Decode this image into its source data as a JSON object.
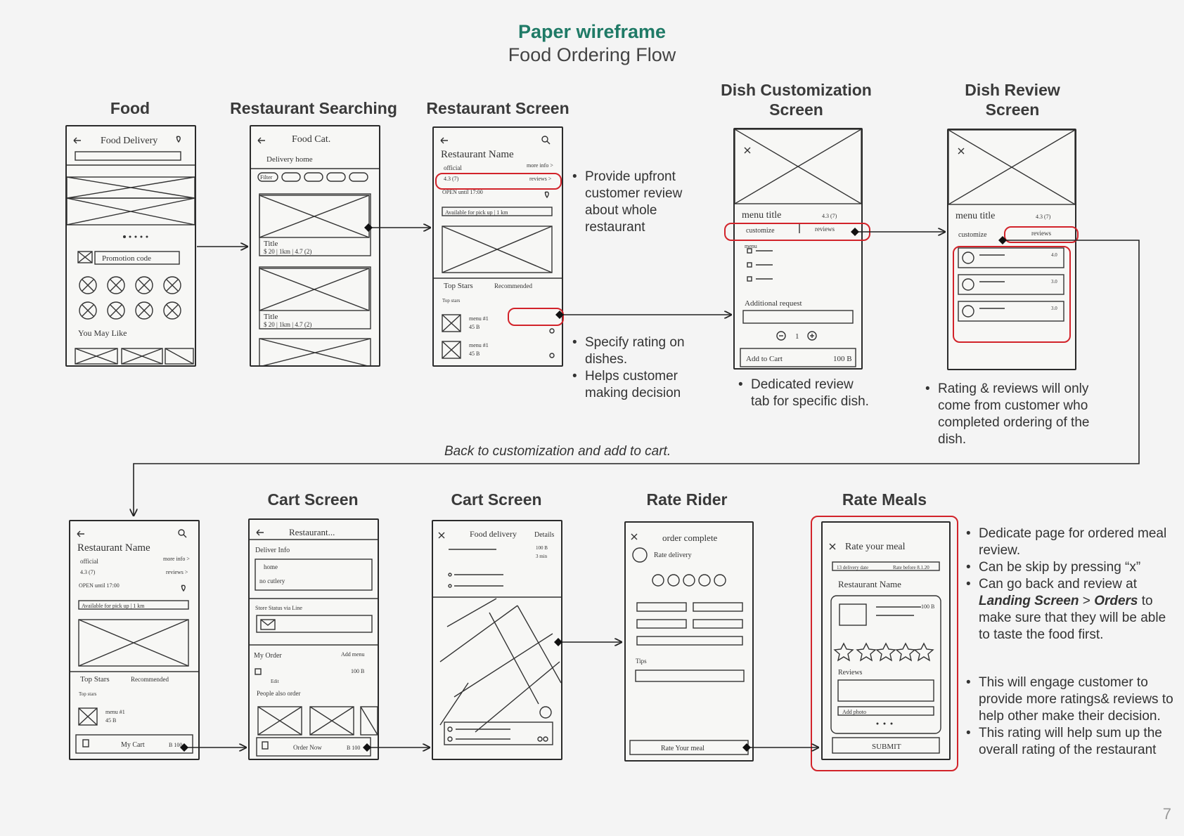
{
  "header": {
    "title": "Paper wireframe",
    "subtitle": "Food Ordering Flow"
  },
  "screens": {
    "food": "Food",
    "search": "Restaurant Searching",
    "restaurant": "Restaurant Screen",
    "customization": "Dish Customization Screen",
    "review": "Dish Review Screen",
    "cart1": "Cart Screen",
    "cart2": "Cart Screen",
    "rider": "Rate Rider",
    "meals": "Rate Meals"
  },
  "sketch": {
    "food": {
      "title": "Food Delivery",
      "promo": "Promotion code",
      "you_may_like": "You May Like"
    },
    "search": {
      "title": "Food Cat.",
      "location": "Delivery home",
      "filter": "Filter",
      "card_title": "Title",
      "card_meta": "$ 20 | 1km | 4.7 (2)"
    },
    "restaurant": {
      "name": "Restaurant Name",
      "official": "official",
      "more_info": "more info >",
      "reviews": "reviews >",
      "rating": "4.3 (7)",
      "open": "OPEN until 17:00",
      "pickup": "Available for pick up | 1 km",
      "top_stars": "Top Stars",
      "recommended": "Recommended",
      "top_stars_sub": "Top stars",
      "menu": "menu #1",
      "price": "45 B"
    },
    "customization": {
      "menu_title": "menu title",
      "rating": "4.3 (7)",
      "tab_customize": "customize",
      "tab_reviews": "reviews",
      "menu": "menu",
      "additional": "Additional request",
      "qty": "1",
      "add_to_cart": "Add to Cart",
      "total": "100 B"
    },
    "review": {
      "menu_title": "menu title",
      "rating": "4.3 (7)",
      "tab_customize": "customize",
      "tab_reviews": "reviews",
      "r1": "4.0",
      "r2": "3.0",
      "r3": "3.0"
    },
    "cart1": {
      "title": "Restaurant...",
      "deliver": "Deliver Info",
      "home": "home",
      "no_cutlery": "no cutlery",
      "store_status": "Store Status via Line",
      "my_order": "My Order",
      "add_menu": "Add menu",
      "price": "100 B",
      "edit": "Edit",
      "also_order": "People also order",
      "order_now": "Order Now",
      "order_price": "B 100"
    },
    "cart0": {
      "my_cart": "My Cart",
      "cart_price": "B 100"
    },
    "cart2": {
      "title": "Food delivery",
      "details": "Details",
      "eta1": "100 B",
      "eta2": "3 min"
    },
    "rider": {
      "title": "order complete",
      "rate": "Rate delivery",
      "tips": "Tips",
      "button": "Rate Your meal"
    },
    "meals": {
      "title": "Rate your meal",
      "delivery": "13 delivery date",
      "rate_before": "Rate before 8.1.20",
      "restaurant": "Restaurant Name",
      "price": "100 B",
      "reviews": "Reviews",
      "add_photo": "Add photo",
      "submit": "SUBMIT"
    }
  },
  "notes": {
    "restaurant": [
      "Provide upfront customer review about whole restaurant"
    ],
    "dish_rating": [
      "Specify rating on dishes.",
      "Helps customer making decision"
    ],
    "customization": [
      "Dedicated review tab for specific dish."
    ],
    "review": [
      "Rating & reviews will only come from customer who completed ordering of the dish."
    ],
    "meals_1": {
      "item1": "Dedicate page for ordered meal review.",
      "item2": "Can be skip by pressing “x”",
      "item3_a": "Can go back and review at ",
      "item3_b": "Landing Screen",
      "item3_c": " > ",
      "item3_d": "Orders",
      "item3_e": " to make sure that they will be able to taste the food first."
    },
    "meals_2": [
      "This will engage customer to provide more ratings& reviews to help other make their decision.",
      "This rating will help sum up the overall rating of the restaurant"
    ]
  },
  "caption": "Back to customization and add to cart.",
  "page_number": "7",
  "colors": {
    "accent": "#1f7a66",
    "highlight": "#d2232a",
    "line": "#2b2b2b"
  }
}
